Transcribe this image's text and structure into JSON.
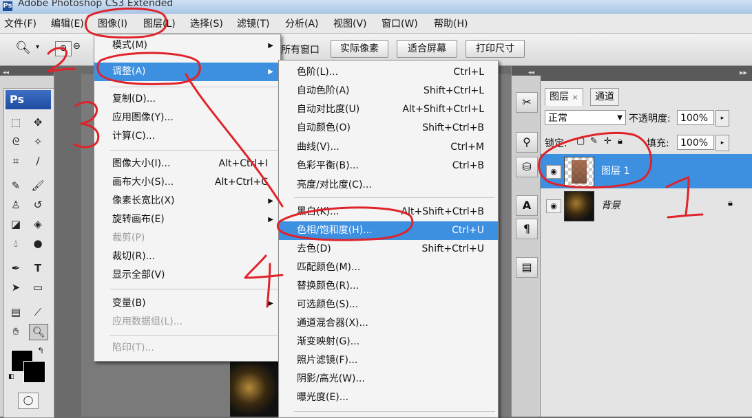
{
  "window": {
    "title": "Adobe Photoshop CS3 Extended",
    "logo": "Ps"
  },
  "menubar": [
    "文件(F)",
    "编辑(E)",
    "图像(I)",
    "图层(L)",
    "选择(S)",
    "滤镜(T)",
    "分析(A)",
    "视图(V)",
    "窗口(W)",
    "帮助(H)"
  ],
  "options": {
    "partial_label": "所有窗口",
    "actual_pixels": "实际像素",
    "fit_screen": "适合屏幕",
    "print_size": "打印尺寸"
  },
  "toolbox": {
    "badge": "Ps"
  },
  "image_menu": {
    "items": [
      {
        "label": "模式(M)",
        "submenu": "▶"
      },
      {
        "label": "调整(A)",
        "submenu": "▶"
      },
      {
        "label": "复制(D)..."
      },
      {
        "label": "应用图像(Y)..."
      },
      {
        "label": "计算(C)..."
      },
      {
        "label": "图像大小(I)...",
        "shortcut": "Alt+Ctrl+I"
      },
      {
        "label": "画布大小(S)...",
        "shortcut": "Alt+Ctrl+C"
      },
      {
        "label": "像素长宽比(X)",
        "submenu": "▶"
      },
      {
        "label": "旋转画布(E)",
        "submenu": "▶"
      },
      {
        "label": "裁剪(P)"
      },
      {
        "label": "裁切(R)..."
      },
      {
        "label": "显示全部(V)"
      },
      {
        "label": "变量(B)",
        "submenu": "▶"
      },
      {
        "label": "应用数据组(L)..."
      },
      {
        "label": "陷印(T)..."
      }
    ]
  },
  "adjust_menu": {
    "items": [
      {
        "label": "色阶(L)...",
        "shortcut": "Ctrl+L"
      },
      {
        "label": "自动色阶(A)",
        "shortcut": "Shift+Ctrl+L"
      },
      {
        "label": "自动对比度(U)",
        "shortcut": "Alt+Shift+Ctrl+L"
      },
      {
        "label": "自动颜色(O)",
        "shortcut": "Shift+Ctrl+B"
      },
      {
        "label": "曲线(V)...",
        "shortcut": "Ctrl+M"
      },
      {
        "label": "色彩平衡(B)...",
        "shortcut": "Ctrl+B"
      },
      {
        "label": "亮度/对比度(C)..."
      },
      {
        "label": "黑白(K)...",
        "shortcut": "Alt+Shift+Ctrl+B"
      },
      {
        "label": "色相/饱和度(H)...",
        "shortcut": "Ctrl+U"
      },
      {
        "label": "去色(D)",
        "shortcut": "Shift+Ctrl+U"
      },
      {
        "label": "匹配颜色(M)..."
      },
      {
        "label": "替换颜色(R)..."
      },
      {
        "label": "可选颜色(S)..."
      },
      {
        "label": "通道混合器(X)..."
      },
      {
        "label": "渐变映射(G)..."
      },
      {
        "label": "照片滤镜(F)..."
      },
      {
        "label": "阴影/高光(W)..."
      },
      {
        "label": "曝光度(E)..."
      }
    ]
  },
  "layers_panel": {
    "tabs": [
      "图层",
      "通道"
    ],
    "blend_mode": "正常",
    "opacity_label": "不透明度:",
    "opacity_value": "100%",
    "lock_label": "锁定:",
    "fill_label": "填充:",
    "fill_value": "100%",
    "layers": [
      {
        "name": "图层 1",
        "selected": true
      },
      {
        "name": "背景",
        "locked": true
      }
    ]
  },
  "annotations": [
    "1",
    "2",
    "3",
    "4"
  ],
  "colors": {
    "highlight": "#3d8fe0",
    "annotation": "#e0222a"
  }
}
